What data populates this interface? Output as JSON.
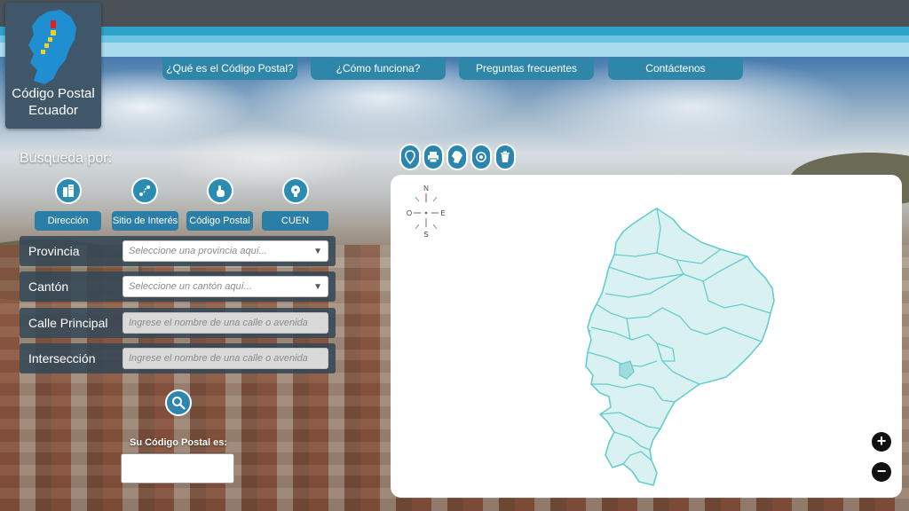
{
  "logo": {
    "line1": "Código Postal",
    "line2": "Ecuador"
  },
  "nav": [
    {
      "label": "¿Qué es el Código Postal?"
    },
    {
      "label": "¿Cómo funciona?"
    },
    {
      "label": "Preguntas frecuentes"
    },
    {
      "label": "Contáctenos"
    }
  ],
  "search": {
    "heading": "Búsqueda por:",
    "types": [
      {
        "label": "Dirección",
        "icon": "building-icon"
      },
      {
        "label": "Sitio de Interés",
        "icon": "route-icon"
      },
      {
        "label": "Código Postal",
        "icon": "hand-pointer-icon"
      },
      {
        "label": "CUEN",
        "icon": "lightbulb-icon"
      }
    ],
    "fields": [
      {
        "label": "Provincia",
        "placeholder": "Seleccione una provincia aquí...",
        "kind": "select"
      },
      {
        "label": "Cantón",
        "placeholder": "Seleccione un cantón aquí...",
        "kind": "select"
      },
      {
        "label": "Calle Principal",
        "placeholder": "Ingrese el nombre de una calle o avenida",
        "kind": "text"
      },
      {
        "label": "Intersección",
        "placeholder": "Ingrese el nombre de una calle o avenida",
        "kind": "text"
      }
    ],
    "result_label": "Su Código Postal es:",
    "result_value": ""
  },
  "map": {
    "tools": [
      "location-pin-icon",
      "print-icon",
      "ecuador-map-icon",
      "search-location-icon",
      "trash-icon"
    ],
    "compass": {
      "n": "N",
      "s": "S",
      "e": "E",
      "o": "O"
    },
    "zoom_in": "+",
    "zoom_out": "−",
    "region_fill": "#d9f1f1",
    "region_stroke": "#66cccc"
  },
  "colors": {
    "accent": "#2b86ad",
    "nav": "#2e87a8",
    "topbar": "#4a5258"
  }
}
